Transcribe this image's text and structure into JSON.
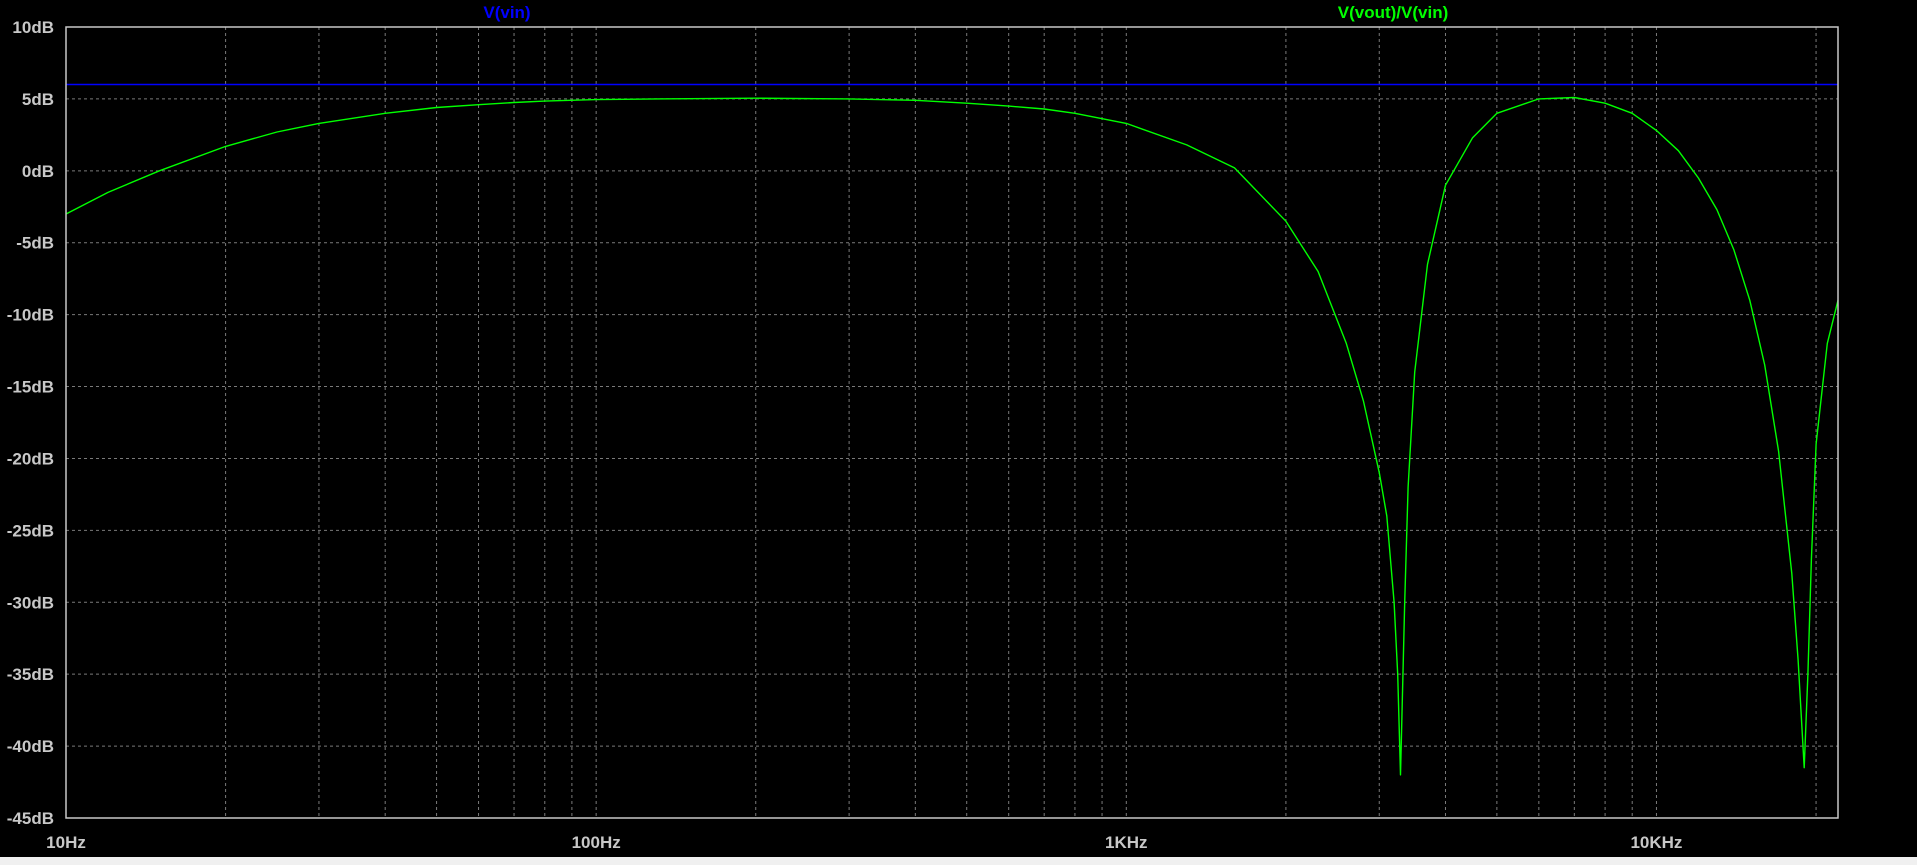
{
  "chart_data": {
    "type": "line",
    "title": "",
    "xlabel": "",
    "ylabel": "",
    "x_scale": "log",
    "xlim": [
      10,
      22000
    ],
    "ylim": [
      -45,
      10
    ],
    "grid": true,
    "legend": "top",
    "colors": {
      "background": "#000000",
      "axis": "#c8c8c8",
      "grid": "#7a7a7a",
      "tick_label": "#c8c8c8"
    },
    "x_tick_labels": [
      {
        "value": 10,
        "label": "10Hz"
      },
      {
        "value": 100,
        "label": "100Hz"
      },
      {
        "value": 1000,
        "label": "1KHz"
      },
      {
        "value": 10000,
        "label": "10KHz"
      }
    ],
    "y_tick_labels": [
      {
        "value": 10,
        "label": "10dB"
      },
      {
        "value": 5,
        "label": "5dB"
      },
      {
        "value": 0,
        "label": "0dB"
      },
      {
        "value": -5,
        "label": "-5dB"
      },
      {
        "value": -10,
        "label": "-10dB"
      },
      {
        "value": -15,
        "label": "-15dB"
      },
      {
        "value": -20,
        "label": "-20dB"
      },
      {
        "value": -25,
        "label": "-25dB"
      },
      {
        "value": -30,
        "label": "-30dB"
      },
      {
        "value": -35,
        "label": "-35dB"
      },
      {
        "value": -40,
        "label": "-40dB"
      },
      {
        "value": -45,
        "label": "-45dB"
      }
    ],
    "series": [
      {
        "name": "V(vin)",
        "color": "#0000ff",
        "x": [
          10,
          22000
        ],
        "y": [
          6.0,
          6.0
        ]
      },
      {
        "name": "V(vout)/V(vin)",
        "color": "#00ff00",
        "x": [
          10,
          12,
          15,
          20,
          25,
          30,
          40,
          50,
          60,
          70,
          80,
          100,
          130,
          200,
          300,
          400,
          500,
          600,
          700,
          800,
          1000,
          1300,
          1600,
          2000,
          2300,
          2600,
          2800,
          3000,
          3100,
          3200,
          3250,
          3290,
          3310,
          3350,
          3400,
          3500,
          3700,
          4000,
          4500,
          5000,
          6000,
          7000,
          8000,
          9000,
          10000,
          11000,
          12000,
          13000,
          14000,
          15000,
          16000,
          17000,
          18000,
          18500,
          19000,
          19300,
          19600,
          20000,
          21000,
          22000
        ],
        "y": [
          -3.0,
          -1.5,
          0.0,
          1.7,
          2.7,
          3.3,
          4.0,
          4.4,
          4.6,
          4.75,
          4.85,
          4.95,
          5.0,
          5.05,
          5.0,
          4.9,
          4.7,
          4.5,
          4.3,
          4.0,
          3.3,
          1.8,
          0.2,
          -3.5,
          -7.0,
          -12.0,
          -16.0,
          -21.0,
          -24.0,
          -30.0,
          -35.0,
          -42.0,
          -38.0,
          -30.0,
          -22.0,
          -14.0,
          -6.5,
          -1.0,
          2.3,
          4.0,
          5.0,
          5.1,
          4.7,
          4.0,
          2.8,
          1.4,
          -0.5,
          -2.7,
          -5.5,
          -9.0,
          -13.5,
          -19.5,
          -28.0,
          -34.0,
          -41.5,
          -35.0,
          -27.0,
          -19.0,
          -12.0,
          -9.0
        ]
      }
    ]
  }
}
